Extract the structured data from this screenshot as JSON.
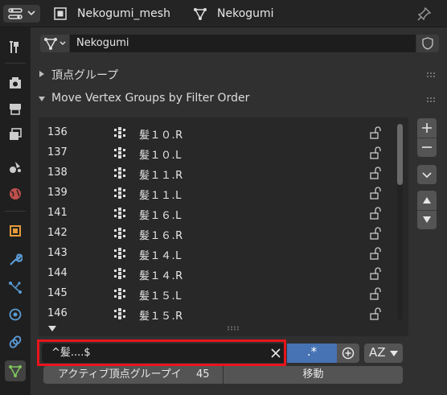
{
  "header": {
    "mesh_name": "Nekogumi_mesh",
    "object_name": "Nekogumi",
    "icons": {
      "editor_type": "properties-editor-icon",
      "mesh": "mesh-data-icon",
      "object": "object-data-icon",
      "pin": "pin-icon"
    }
  },
  "tabs": [
    {
      "name": "tool",
      "icon": "tool-icon"
    },
    {
      "name": "render",
      "icon": "render-icon"
    },
    {
      "name": "output",
      "icon": "output-icon"
    },
    {
      "name": "view-layer",
      "icon": "view-layer-icon"
    },
    {
      "name": "scene",
      "icon": "scene-icon"
    },
    {
      "name": "world",
      "icon": "world-icon"
    },
    {
      "name": "object",
      "icon": "object-icon"
    },
    {
      "name": "modifiers",
      "icon": "wrench-icon"
    },
    {
      "name": "particles",
      "icon": "particles-icon"
    },
    {
      "name": "physics",
      "icon": "physics-icon"
    },
    {
      "name": "constraints",
      "icon": "constraints-icon"
    },
    {
      "name": "data",
      "icon": "mesh-data-icon",
      "active": true
    }
  ],
  "object_field": {
    "value": "Nekogumi"
  },
  "sections": {
    "vertex_groups": "頂点グループ",
    "move_vertex_groups": "Move Vertex Groups by Filter Order"
  },
  "list": {
    "rows": [
      {
        "index": "136",
        "name": "髪１０.R"
      },
      {
        "index": "137",
        "name": "髪１０.L"
      },
      {
        "index": "138",
        "name": "髪１１.R"
      },
      {
        "index": "139",
        "name": "髪１１.L"
      },
      {
        "index": "141",
        "name": "髪１６.L"
      },
      {
        "index": "142",
        "name": "髪１６.R"
      },
      {
        "index": "143",
        "name": "髪１４.L"
      },
      {
        "index": "144",
        "name": "髪１４.R"
      },
      {
        "index": "145",
        "name": "髪１５.L"
      },
      {
        "index": "146",
        "name": "髪１５.R"
      }
    ]
  },
  "filter": {
    "value": "^髪....$",
    "regex_label": ".*",
    "sort_label": "AZ"
  },
  "bottom": {
    "active_label": "アクティブ頂点グループイ",
    "active_value": "45",
    "move_label": "移動"
  },
  "colors": {
    "accent": "#4772b3",
    "highlight": "#e8141c",
    "data_tab": "#7ec45b"
  }
}
